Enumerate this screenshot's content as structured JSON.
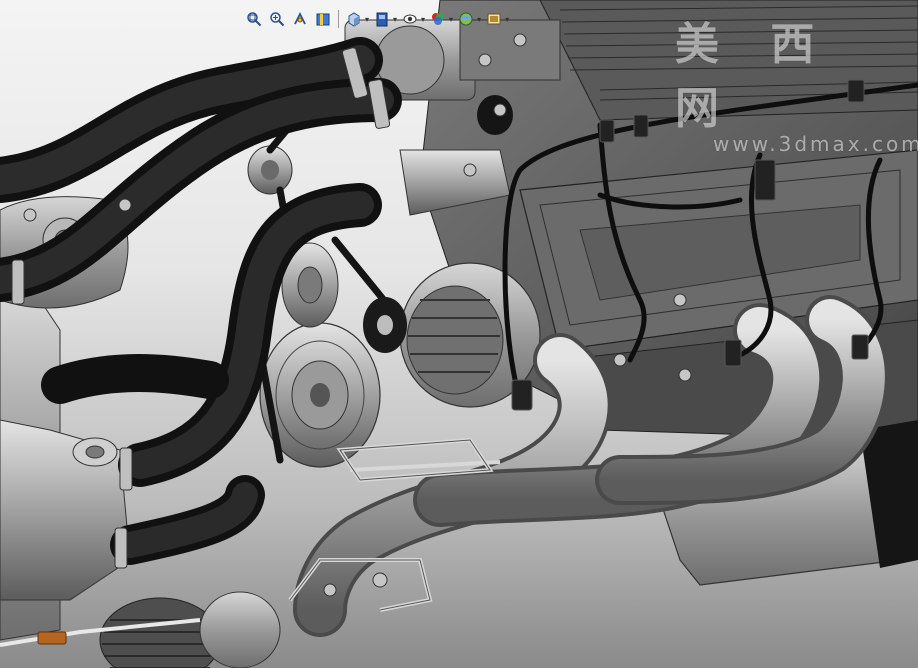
{
  "app": {
    "type": "cad-3d-viewer",
    "model": "v8-engine-assembly",
    "render_mode": "shaded-with-edges"
  },
  "toolbar": {
    "buttons": [
      {
        "name": "zoom-to-fit",
        "icon": "zoom-fit-icon"
      },
      {
        "name": "zoom-to-area",
        "icon": "zoom-area-icon"
      },
      {
        "name": "previous-view",
        "icon": "previous-view-icon"
      },
      {
        "name": "section-view",
        "icon": "section-view-icon"
      },
      {
        "name": "view-orientation",
        "icon": "view-orientation-icon",
        "has_dropdown": true
      },
      {
        "name": "display-style",
        "icon": "display-style-icon",
        "has_dropdown": true
      },
      {
        "name": "hide-show-items",
        "icon": "hide-show-icon",
        "has_dropdown": true
      },
      {
        "name": "edit-appearance",
        "icon": "appearance-icon",
        "has_dropdown": true
      },
      {
        "name": "apply-scene",
        "icon": "scene-icon",
        "has_dropdown": true
      },
      {
        "name": "view-settings",
        "icon": "view-settings-icon",
        "has_dropdown": true
      }
    ]
  },
  "watermark": {
    "title": "美 西 网",
    "subtitle": "www.3dmax.com"
  },
  "colors": {
    "hose": "#1a1a1a",
    "metal": "#8c8c8c",
    "metal_light": "#c4c4c4",
    "background_top": "#f4f4f4",
    "background_bottom": "#8a8a8a",
    "accent_red": "#d6262a",
    "accent_green": "#3aa648",
    "accent_blue": "#2a6ad6"
  }
}
